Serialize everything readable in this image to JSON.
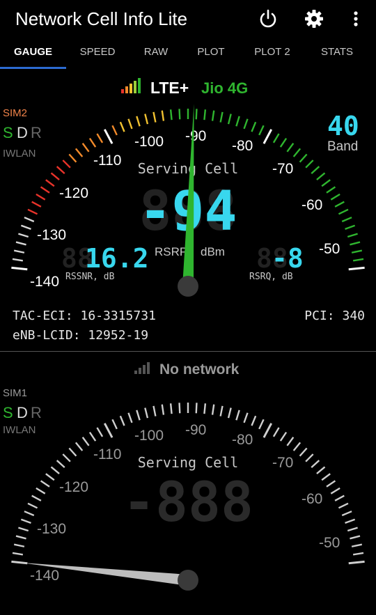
{
  "app": {
    "title": "Network Cell Info Lite",
    "actions": {
      "power": "power-icon",
      "settings": "gear-icon",
      "more": "more-vert-icon"
    }
  },
  "tabs": [
    {
      "label": "GAUGE",
      "active": true
    },
    {
      "label": "SPEED",
      "active": false
    },
    {
      "label": "RAW",
      "active": false
    },
    {
      "label": "PLOT",
      "active": false
    },
    {
      "label": "PLOT 2",
      "active": false
    },
    {
      "label": "STATS",
      "active": false
    }
  ],
  "colors": {
    "accent": "#2c6bd1",
    "lcd": "#38d7ee",
    "needle": "#2fb52f",
    "good": "#2fb52f",
    "warn": "#f2c230",
    "bad": "#e8332a"
  },
  "sim2": {
    "network_type": "LTE+",
    "operator": "Jio 4G",
    "sim_label": "SIM2",
    "sdr": [
      "S",
      "D",
      "R"
    ],
    "iwlan": "IWLAN",
    "band_value": "40",
    "band_label": "Band",
    "gauge_title": "Serving Cell",
    "main_value": "-94",
    "main_unit_left": "RSRP",
    "main_unit_right": "dBm",
    "rssnr_value": "16.2",
    "rssnr_label": "RSSNR, dB",
    "rsrq_value": "-8",
    "rsrq_label": "RSRQ, dB",
    "tac_eci": "TAC-ECI: 16-3315731",
    "enb_lcid": "eNB-LCID: 12952-19",
    "pci": "PCI: 340",
    "scale_labels": [
      "-140",
      "-130",
      "-120",
      "-110",
      "-100",
      "-90",
      "-80",
      "-70",
      "-60",
      "-50"
    ],
    "signal_level": -94
  },
  "sim1": {
    "status": "No network",
    "sim_label": "SIM1",
    "sdr": [
      "S",
      "D",
      "R"
    ],
    "iwlan": "IWLAN",
    "gauge_title": "Serving Cell",
    "scale_labels": [
      "-140",
      "-130",
      "-120",
      "-110",
      "-100",
      "-90",
      "-80",
      "-70",
      "-60",
      "-50"
    ],
    "signal_level": -140
  }
}
